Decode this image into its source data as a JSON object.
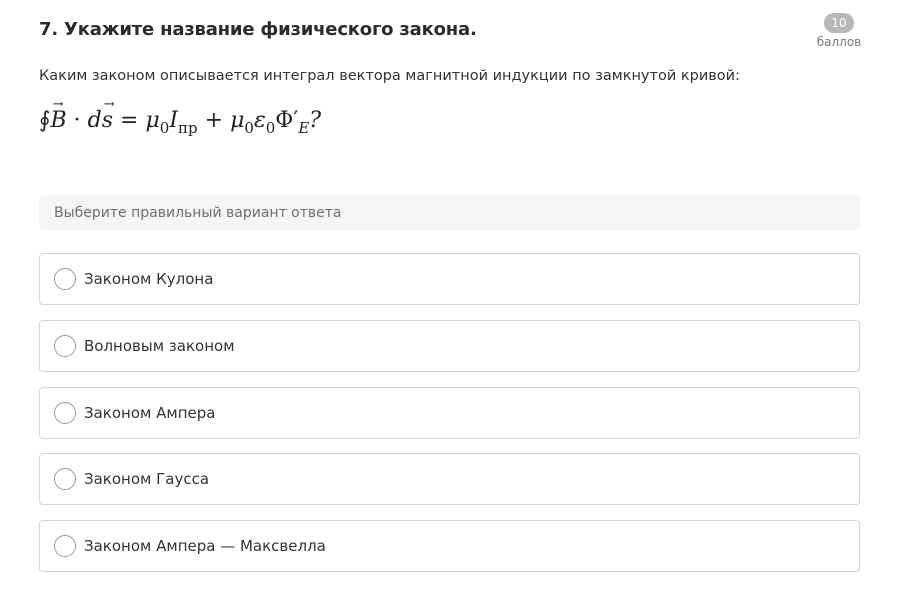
{
  "question": {
    "title": "7. Укажите название физического закона.",
    "points_value": "10",
    "points_label": "баллов",
    "text": "Каким законом описывается интеграл вектора магнитной индукции по замкнутой кривой:",
    "formula": {
      "integral": "∮",
      "B": "B",
      "dot": "·",
      "ds_d": "d",
      "ds_s": "s",
      "equals": "=",
      "mu1": "μ",
      "mu1_sub": "0",
      "I": "I",
      "I_sub": "пр",
      "plus": "+",
      "mu2": "μ",
      "mu2_sub": "0",
      "eps": "ε",
      "eps_sub": "0",
      "phi": "Φ′",
      "phi_sub": "E",
      "qmark": "?"
    }
  },
  "answer_prompt": "Выберите правильный вариант ответа",
  "options": [
    {
      "label": "Законом Кулона"
    },
    {
      "label": "Волновым законом"
    },
    {
      "label": "Законом Ампера"
    },
    {
      "label": "Законом Гаусса"
    },
    {
      "label": "Законом Ампера — Максвелла"
    }
  ]
}
